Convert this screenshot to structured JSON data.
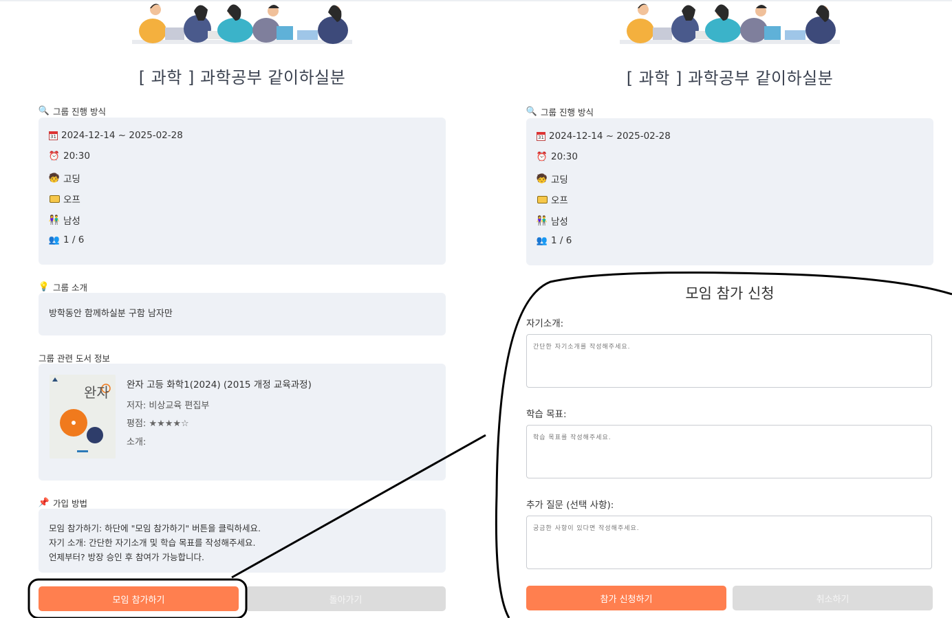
{
  "left": {
    "title": "[ 과학 ] 과학공부 같이하실분",
    "sections": {
      "method": "그룹 진행 방식",
      "intro": "그룹 소개",
      "book": "그룹 관련 도서 정보",
      "join": "가입 방법"
    },
    "info": {
      "date": "2024-12-14 ~ 2025-02-28",
      "time": "20:30",
      "level": "고딩",
      "mode": "오프",
      "gender": "남성",
      "members": "1 / 6"
    },
    "intro_text": "방학동안 함께하실분 구함 남자만",
    "book": {
      "title": "완자 고등 화학1(2024) (2015 개정 교육과정)",
      "author": "저자: 비상교육 편집부",
      "rating_label": "평점: ",
      "rating_stars": "★★★★☆",
      "desc": "소개:",
      "cover_text": "완자"
    },
    "join_steps": [
      "모임 참가하기: 하단에 \"모임 참가하기\" 버튼을 클릭하세요.",
      "자기 소개: 간단한 자기소개 및 학습 목표를 작성해주세요.",
      "언제부터? 방장 승인 후 참여가 가능합니다."
    ],
    "buttons": {
      "join": "모임 참가하기",
      "back": "돌아가기"
    }
  },
  "right": {
    "title": "[ 과학 ] 과학공부 같이하실분",
    "sections": {
      "method": "그룹 진행 방식"
    },
    "info": {
      "date": "2024-12-14 ~ 2025-02-28",
      "time": "20:30",
      "level": "고딩",
      "mode": "오프",
      "gender": "남성",
      "members": "1 / 6"
    },
    "form": {
      "title": "모임 참가 신청",
      "intro_label": "자기소개:",
      "intro_placeholder": "간단한 자기소개를 작성해주세요.",
      "goal_label": "학습 목표:",
      "goal_placeholder": "학습 목표를 작성해주세요.",
      "extra_label": "추가 질문 (선택 사항):",
      "extra_placeholder": "궁금한 사항이 있다면 작성해주세요.",
      "submit": "참가 신청하기",
      "cancel": "취소하기"
    }
  },
  "colors": {
    "accent": "#ff7f4f",
    "box_bg": "#eef1f6",
    "gray_button": "#dcdcdc"
  },
  "icons": [
    "magnifier-icon",
    "calendar-icon",
    "alarm-clock-icon",
    "child-face-icon",
    "folder-icon",
    "couple-icon",
    "people-icon",
    "lightbulb-icon",
    "pushpin-icon"
  ]
}
